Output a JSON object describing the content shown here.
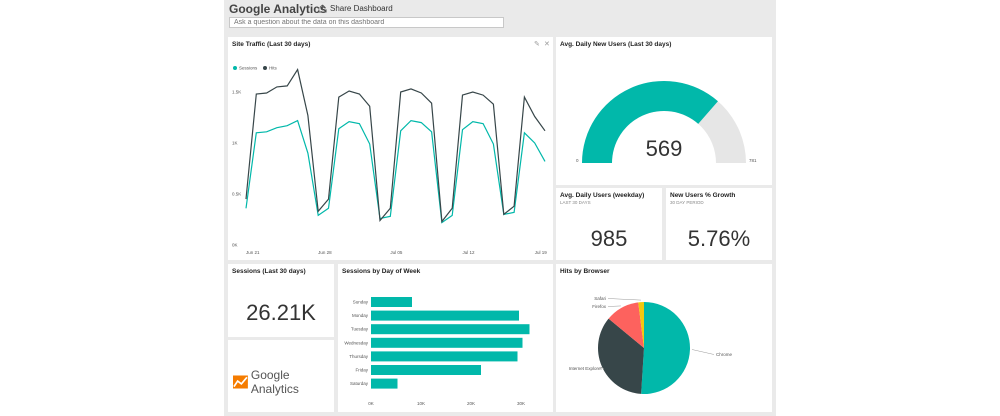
{
  "header": {
    "title": "Google Analytics",
    "share_label": "Share Dashboard"
  },
  "qa": {
    "placeholder": "Ask a question about the data on this dashboard"
  },
  "tiles": {
    "site_traffic": {
      "title": "Site Traffic (Last 30 days)",
      "legend": [
        "Sessions",
        "Hits"
      ]
    },
    "gauge": {
      "title": "Avg. Daily New Users (Last 30 days)",
      "value": "569",
      "min": "0",
      "max": "781"
    },
    "avg_users": {
      "title": "Avg. Daily Users (weekday)",
      "subtitle": "LAST 30 DAYS",
      "value": "985"
    },
    "growth": {
      "title": "New Users % Growth",
      "subtitle": "30 DAY PERIOD",
      "value": "5.76%"
    },
    "sessions": {
      "title": "Sessions (Last 30 days)",
      "value": "26.21K"
    },
    "logo": {
      "text": "Google Analytics"
    },
    "dow": {
      "title": "Sessions by Day of Week"
    },
    "browser": {
      "title": "Hits by Browser"
    }
  },
  "colors": {
    "teal": "#01B8AA",
    "dark": "#374649",
    "red": "#FD625E",
    "yellow": "#F2C80F",
    "gauge_bg": "#e6e6e6"
  },
  "chart_data": [
    {
      "type": "line",
      "title": "Site Traffic (Last 30 days)",
      "x_tick_labels": [
        "Jun 21",
        "Jun 28",
        "Jul 05",
        "Jul 12",
        "Jul 19"
      ],
      "y_tick_labels": [
        "0K",
        "0.5K",
        "1K",
        "1.5K"
      ],
      "ylim": [
        0,
        1500
      ],
      "series": [
        {
          "name": "Sessions",
          "color": "#01B8AA",
          "values": [
            360,
            1100,
            1110,
            1150,
            1170,
            1220,
            900,
            290,
            360,
            1140,
            1210,
            1190,
            990,
            260,
            280,
            1120,
            1220,
            1200,
            1110,
            220,
            290,
            1130,
            1210,
            1190,
            990,
            300,
            320,
            1100,
            1000,
            820
          ]
        },
        {
          "name": "Hits",
          "color": "#374649",
          "values": [
            450,
            1480,
            1490,
            1550,
            1560,
            1720,
            1270,
            330,
            450,
            1450,
            1510,
            1480,
            1360,
            240,
            360,
            1500,
            1530,
            1490,
            1390,
            230,
            360,
            1470,
            1500,
            1470,
            1380,
            300,
            380,
            1450,
            1260,
            1120
          ]
        }
      ]
    },
    {
      "type": "gauge",
      "title": "Avg. Daily New Users (Last 30 days)",
      "value": 569,
      "min": 0,
      "max": 781
    },
    {
      "type": "bar",
      "title": "Sessions by Day of Week",
      "categories": [
        "Sunday",
        "Monday",
        "Tuesday",
        "Wednesday",
        "Thursday",
        "Friday",
        "Saturday"
      ],
      "values": [
        8200,
        29600,
        31700,
        30300,
        29300,
        22000,
        5300
      ],
      "x_tick_labels": [
        "0K",
        "10K",
        "20K",
        "30K"
      ],
      "xlim": [
        0,
        30000
      ]
    },
    {
      "type": "pie",
      "title": "Hits by Browser",
      "labels": [
        "Chrome",
        "Internet Explorer",
        "Firefox",
        "Safari"
      ],
      "values": [
        51,
        35,
        12,
        2
      ],
      "colors": [
        "#01B8AA",
        "#374649",
        "#FD625E",
        "#F2C80F"
      ]
    }
  ]
}
